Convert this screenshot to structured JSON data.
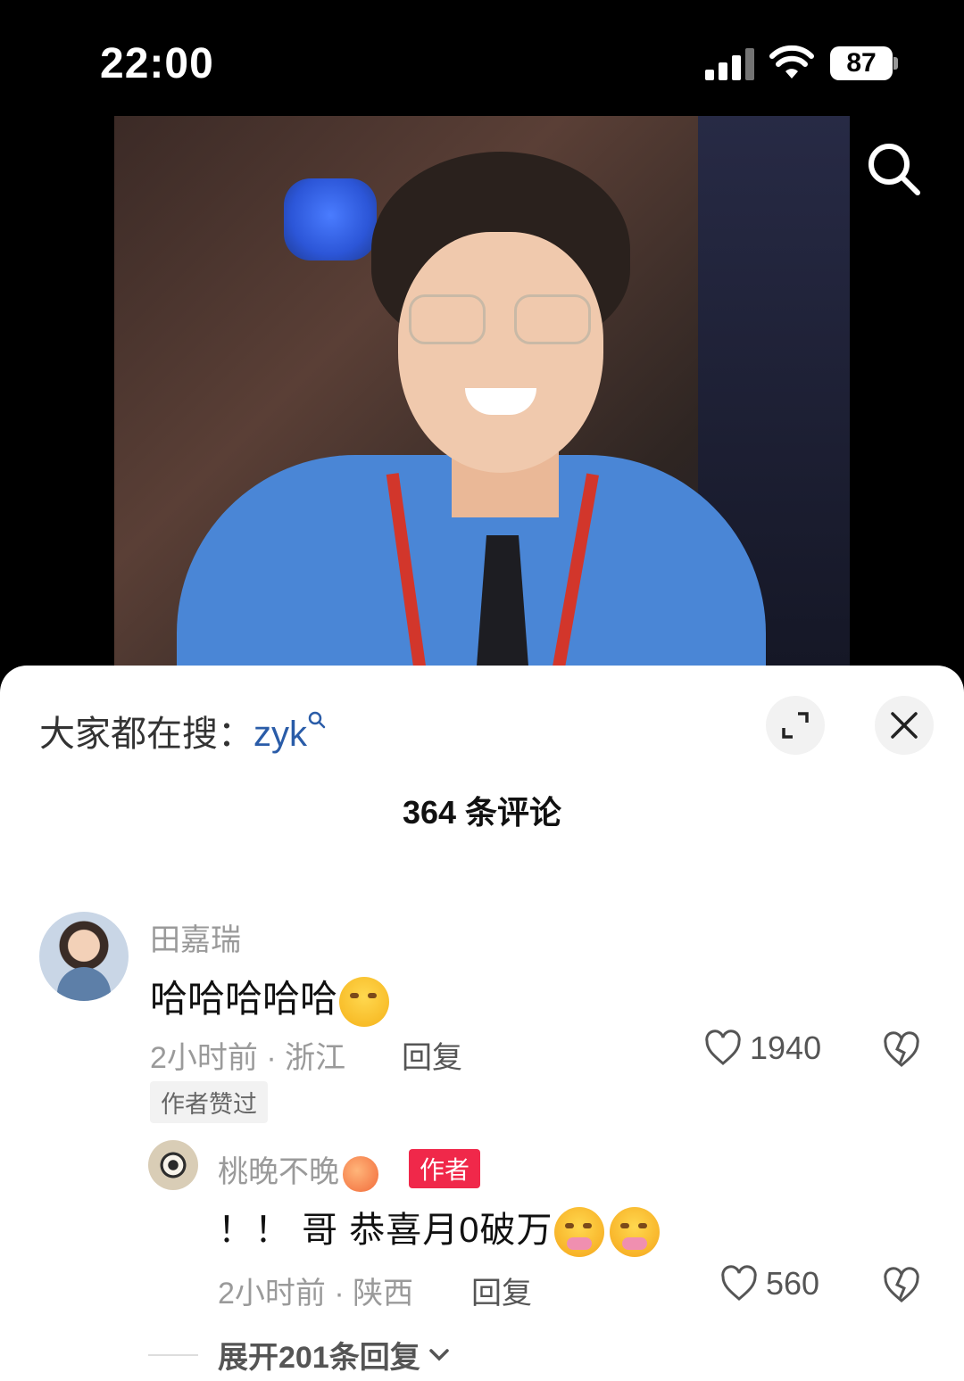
{
  "status_bar": {
    "time": "22:00",
    "battery": "87"
  },
  "sheet": {
    "search_prefix": "大家都在搜：",
    "search_keyword": "zyk",
    "comment_count": "364 条评论"
  },
  "comment": {
    "author": "田嘉瑞",
    "text": "哈哈哈哈哈",
    "meta": "2小时前 · 浙江",
    "reply_label": "回复",
    "likes": "1940",
    "author_liked": "作者赞过"
  },
  "reply": {
    "author": "桃晚不晚",
    "badge": "作者",
    "text": "！！ 哥  恭喜月0破万",
    "meta": "2小时前 · 陕西",
    "reply_label": "回复",
    "likes": "560"
  },
  "expand_replies": "展开201条回复"
}
